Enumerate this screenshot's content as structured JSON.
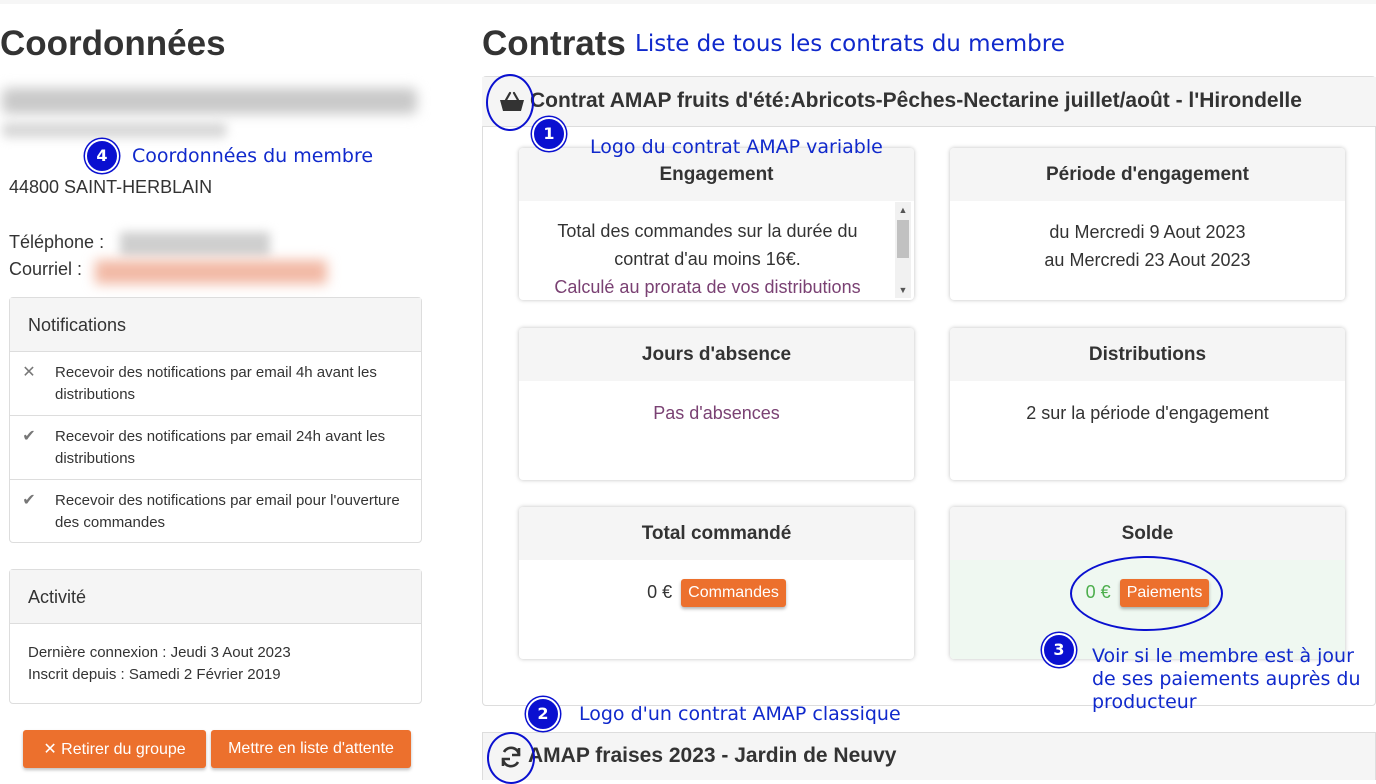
{
  "left": {
    "title": "Coordonnées",
    "city": "44800 SAINT-HERBLAIN",
    "phone_label": "Téléphone :",
    "email_label": "Courriel :",
    "notifications": {
      "title": "Notifications",
      "items": [
        {
          "icon": "x-icon",
          "text": "Recevoir des notifications par email 4h avant les distributions"
        },
        {
          "icon": "check-icon",
          "text": "Recevoir des notifications par email 24h avant les distributions"
        },
        {
          "icon": "check-icon",
          "text": "Recevoir des notifications par email pour l'ouverture des commandes"
        }
      ]
    },
    "activity": {
      "title": "Activité",
      "last_login": "Dernière connexion : Jeudi 3 Aout 2023",
      "member_since": "Inscrit depuis : Samedi 2 Février 2019"
    },
    "buttons": {
      "remove": "✕ Retirer du groupe",
      "waitlist": "Mettre en liste d'attente"
    }
  },
  "contracts": {
    "title": "Contrats",
    "first": {
      "title": "Contrat AMAP fruits d'été:Abricots-Pêches-Nectarine juillet/août - l'Hirondelle",
      "icon": "basket-icon",
      "engagement": {
        "title": "Engagement",
        "text": "Total des commandes sur la durée du contrat d'au moins 16€.",
        "note": "Calculé au prorata de vos distributions"
      },
      "periode": {
        "title": "Période d'engagement",
        "from": "du Mercredi 9 Aout 2023",
        "to": "au Mercredi 23 Aout 2023"
      },
      "absences": {
        "title": "Jours d'absence",
        "value": "Pas d'absences"
      },
      "distributions": {
        "title": "Distributions",
        "value": "2 sur la période d'engagement"
      },
      "total": {
        "title": "Total commandé",
        "value": "0 €",
        "button": "Commandes"
      },
      "solde": {
        "title": "Solde",
        "value": "0 €",
        "button": "Paiements"
      }
    },
    "second": {
      "title": "AMAP fraises 2023 - Jardin de Neuvy",
      "icon": "refresh-icon"
    }
  },
  "annotations": {
    "list": "Liste de tous les contrats du membre",
    "a1": "Logo du contrat AMAP variable",
    "a2": "Logo d'un contrat AMAP classique",
    "a3": "Voir si le membre est à jour de ses paiements auprès du producteur",
    "a4": "Coordonnées du membre",
    "n1": "1",
    "n2": "2",
    "n3": "3",
    "n4": "4"
  },
  "colors": {
    "accent_orange": "#ec702d",
    "annotation_blue": "#1029cc",
    "purple_text": "#7a4173",
    "green_text": "#4cae4c"
  }
}
